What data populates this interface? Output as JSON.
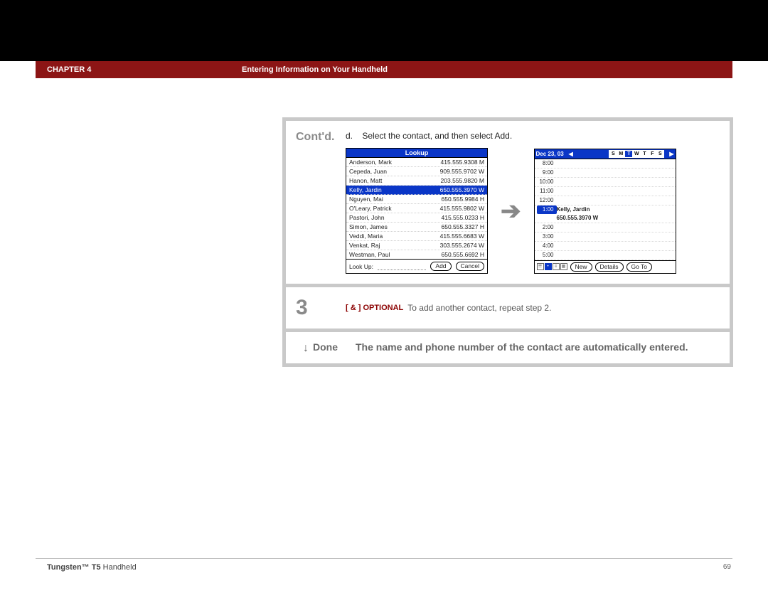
{
  "header": {
    "chapter": "CHAPTER 4",
    "title": "Entering Information on Your Handheld"
  },
  "contd": {
    "label": "Cont'd.",
    "instruction_prefix": "d.",
    "instruction": "Select the contact, and then select Add."
  },
  "lookup": {
    "title": "Lookup",
    "rows": [
      {
        "name": "Anderson, Mark",
        "phone": "415.555.9308 M"
      },
      {
        "name": "Cepeda, Juan",
        "phone": "909.555.9702 W"
      },
      {
        "name": "Hanon, Matt",
        "phone": "203.555.9820 M"
      },
      {
        "name": "Kelly, Jardin",
        "phone": "650.555.3970 W",
        "selected": true
      },
      {
        "name": "Nguyen, Mai",
        "phone": "650.555.9984 H"
      },
      {
        "name": "O'Leary, Patrick",
        "phone": "415.555.9802 W"
      },
      {
        "name": "Pastori, John",
        "phone": "415.555.0233 H"
      },
      {
        "name": "Simon, James",
        "phone": "650.555.3327 H"
      },
      {
        "name": "Veddi, Maria",
        "phone": "415.555.6683 W"
      },
      {
        "name": "Venkat, Raj",
        "phone": "303.555.2674 W"
      },
      {
        "name": "Westman, Paul",
        "phone": "650.555.6692 H"
      }
    ],
    "foot_label": "Look Up:",
    "btn_add": "Add",
    "btn_cancel": "Cancel"
  },
  "calendar": {
    "date": "Dec 23, 03",
    "dow": [
      "S",
      "M",
      "T",
      "W",
      "T",
      "F",
      "S"
    ],
    "dow_selected_index": 2,
    "rows": [
      {
        "time": "8:00"
      },
      {
        "time": "9:00"
      },
      {
        "time": "10:00"
      },
      {
        "time": "11:00"
      },
      {
        "time": "12:00"
      },
      {
        "time": "1:00",
        "selected": true,
        "line1": "Kelly, Jardin",
        "line2": "650.555.3970 W"
      },
      {
        "time": "2:00"
      },
      {
        "time": "3:00"
      },
      {
        "time": "4:00"
      },
      {
        "time": "5:00"
      }
    ],
    "btn_new": "New",
    "btn_details": "Details",
    "btn_goto": "Go To"
  },
  "step3": {
    "number": "3",
    "optional_tag": "[ & ]  OPTIONAL",
    "optional_text": "To add another contact, repeat step 2."
  },
  "done": {
    "arrow": "↓",
    "label": "Done",
    "text": "The name and phone number of the contact are automatically entered."
  },
  "footer": {
    "product_bold": "Tungsten™ T5",
    "product_rest": " Handheld",
    "page": "69"
  }
}
